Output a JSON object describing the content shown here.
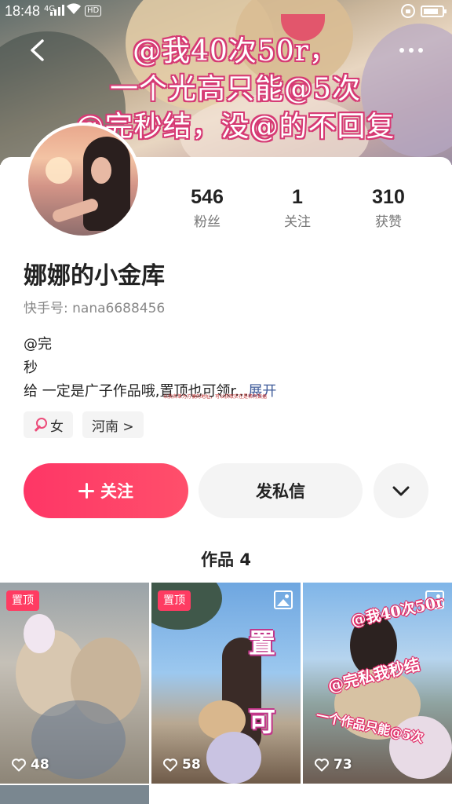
{
  "status_bar": {
    "time": "18:48",
    "network": "4G"
  },
  "cover": {
    "lines": [
      "@我40次50r，",
      "一个光高只能@5次",
      "@完秒结，没@的不回复"
    ]
  },
  "profile": {
    "stats": [
      {
        "value": "546",
        "label": "粉丝"
      },
      {
        "value": "1",
        "label": "关注"
      },
      {
        "value": "310",
        "label": "获赞"
      }
    ],
    "name": "娜娜的小金库",
    "kuaishou_id": "快手号: nana6688456",
    "bio": {
      "line1": "@完",
      "line2": "秒",
      "line3": "给 一定是广子作品哦,置顶也可领r...",
      "expand": "展开",
      "tiny_overlay": "以我名单为方便的地址，可以获取实在是稀有数据"
    },
    "tags": {
      "gender": "女",
      "region": "河南 >"
    },
    "actions": {
      "follow": "关注",
      "message": "发私信"
    },
    "works_title": "作品 4"
  },
  "works": [
    {
      "pinned_label": "置顶",
      "likes": "48"
    },
    {
      "pinned_label": "置顶",
      "likes": "58",
      "overlay": [
        "置",
        "可"
      ]
    },
    {
      "likes": "73",
      "overlay": [
        "@我40次50r",
        "@完私我秒结",
        "一个作品只能@5次"
      ]
    }
  ],
  "colors": {
    "accent": "#fe3666",
    "expand_link": "#3d5a99",
    "pin_badge": "#fe3c62"
  }
}
